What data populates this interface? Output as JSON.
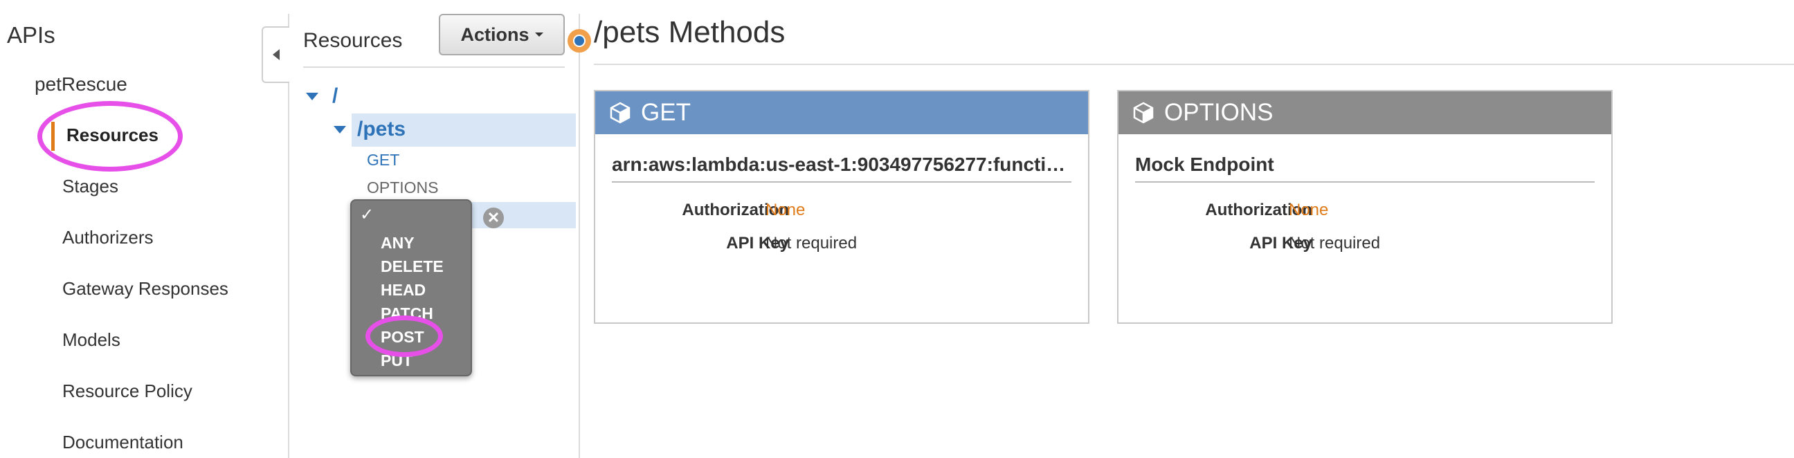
{
  "nav": {
    "title": "APIs",
    "api_name": "petRescue",
    "items": [
      {
        "label": "Resources"
      },
      {
        "label": "Stages"
      },
      {
        "label": "Authorizers"
      },
      {
        "label": "Gateway Responses"
      },
      {
        "label": "Models"
      },
      {
        "label": "Resource Policy"
      },
      {
        "label": "Documentation"
      }
    ]
  },
  "resources": {
    "title": "Resources",
    "actions_label": "Actions",
    "tree": {
      "root": "/",
      "pets": "/pets",
      "methods": [
        "GET",
        "OPTIONS"
      ]
    },
    "method_dropdown": {
      "check": "✓",
      "options": [
        "ANY",
        "DELETE",
        "HEAD",
        "PATCH",
        "POST",
        "PUT"
      ]
    },
    "cancel_symbol": "✕"
  },
  "main": {
    "title": "/pets Methods",
    "cards": [
      {
        "method": "GET",
        "header_color": "#6b94c4",
        "endpoint": "arn:aws:lambda:us-east-1:903497756277:functi…",
        "auth_label": "Authorization",
        "auth_value": "None",
        "apikey_label": "API Key",
        "apikey_value": "Not required"
      },
      {
        "method": "OPTIONS",
        "header_color": "#8c8c8c",
        "endpoint": "Mock Endpoint",
        "auth_label": "Authorization",
        "auth_value": "None",
        "apikey_label": "API Key",
        "apikey_value": "Not required"
      }
    ]
  },
  "colors": {
    "accent_orange": "#e07b1a",
    "link_blue": "#2e73b8",
    "highlight_ring": "#e64fe8"
  }
}
